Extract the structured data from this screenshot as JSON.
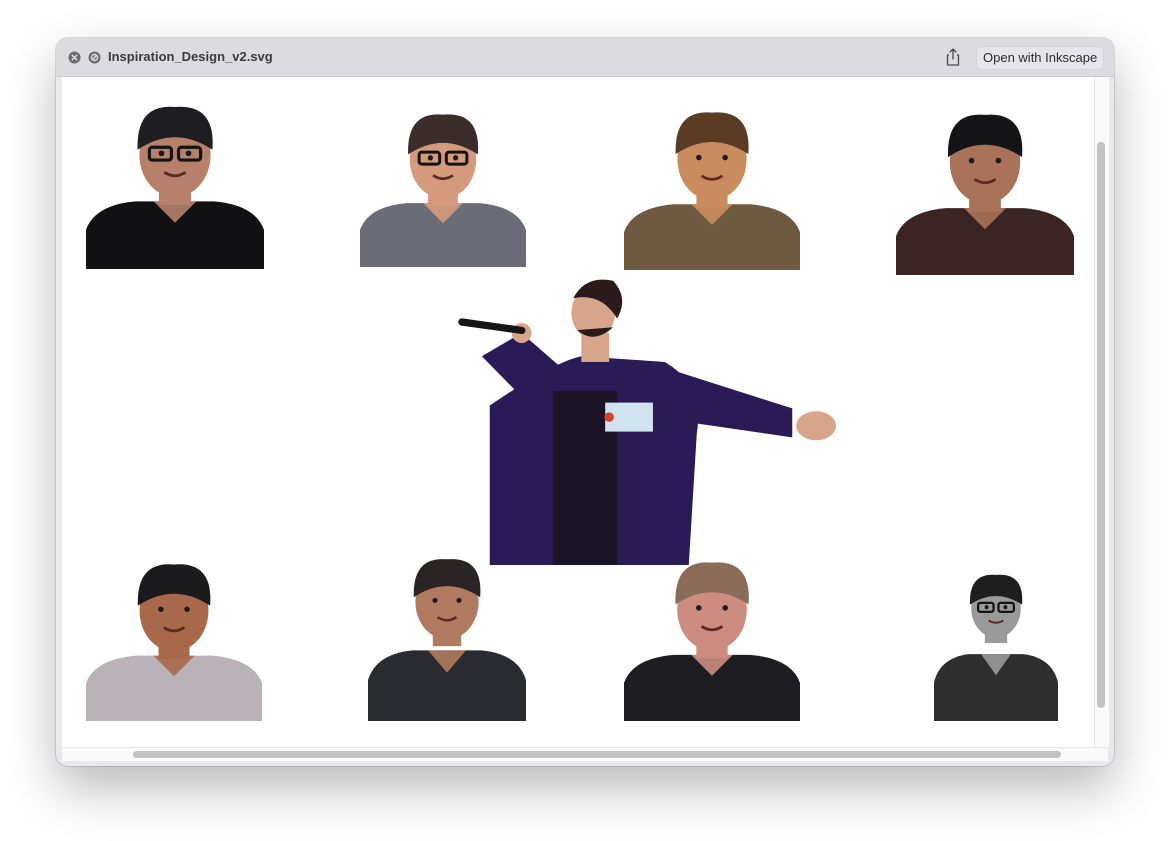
{
  "window": {
    "title": "Inspiration_Design_v2.svg",
    "open_button_label": "Open with Inkscape"
  },
  "icons": {
    "close": "close-icon",
    "stop": "block-icon",
    "share": "share-icon"
  },
  "canvas": {
    "portraits": [
      {
        "label": "portrait-top-1",
        "skin": "#b6806a",
        "hair": "#1e1e22",
        "shirt": "#111114",
        "glasses": true
      },
      {
        "label": "portrait-top-2",
        "skin": "#d59a7c",
        "hair": "#3a2d2a",
        "shirt": "#6a6d78",
        "glasses": true
      },
      {
        "label": "portrait-top-3",
        "skin": "#c98c5e",
        "hair": "#5a3b23",
        "shirt": "#6e5a40",
        "glasses": false
      },
      {
        "label": "portrait-top-4",
        "skin": "#a97359",
        "hair": "#151518",
        "shirt": "#3b2424",
        "glasses": false
      },
      {
        "label": "portrait-center-singer",
        "skin": "#d7a58a",
        "hair": "#2a1a1a",
        "shirt": "#2a1a55"
      },
      {
        "label": "portrait-bottom-1",
        "skin": "#a8684a",
        "hair": "#1b1b1e",
        "shirt": "#b9b3b8",
        "glasses": false
      },
      {
        "label": "portrait-bottom-2",
        "skin": "#b07b5e",
        "hair": "#2a2424",
        "shirt": "#2a2b30",
        "glasses": false
      },
      {
        "label": "portrait-bottom-3",
        "skin": "#cc8d80",
        "hair": "#8b6c58",
        "shirt": "#1d1d22",
        "glasses": false
      },
      {
        "label": "portrait-bottom-4",
        "skin": "#9a9a9a",
        "hair": "#1e1e1e",
        "shirt": "#2e2e2e",
        "glasses": true
      }
    ]
  }
}
